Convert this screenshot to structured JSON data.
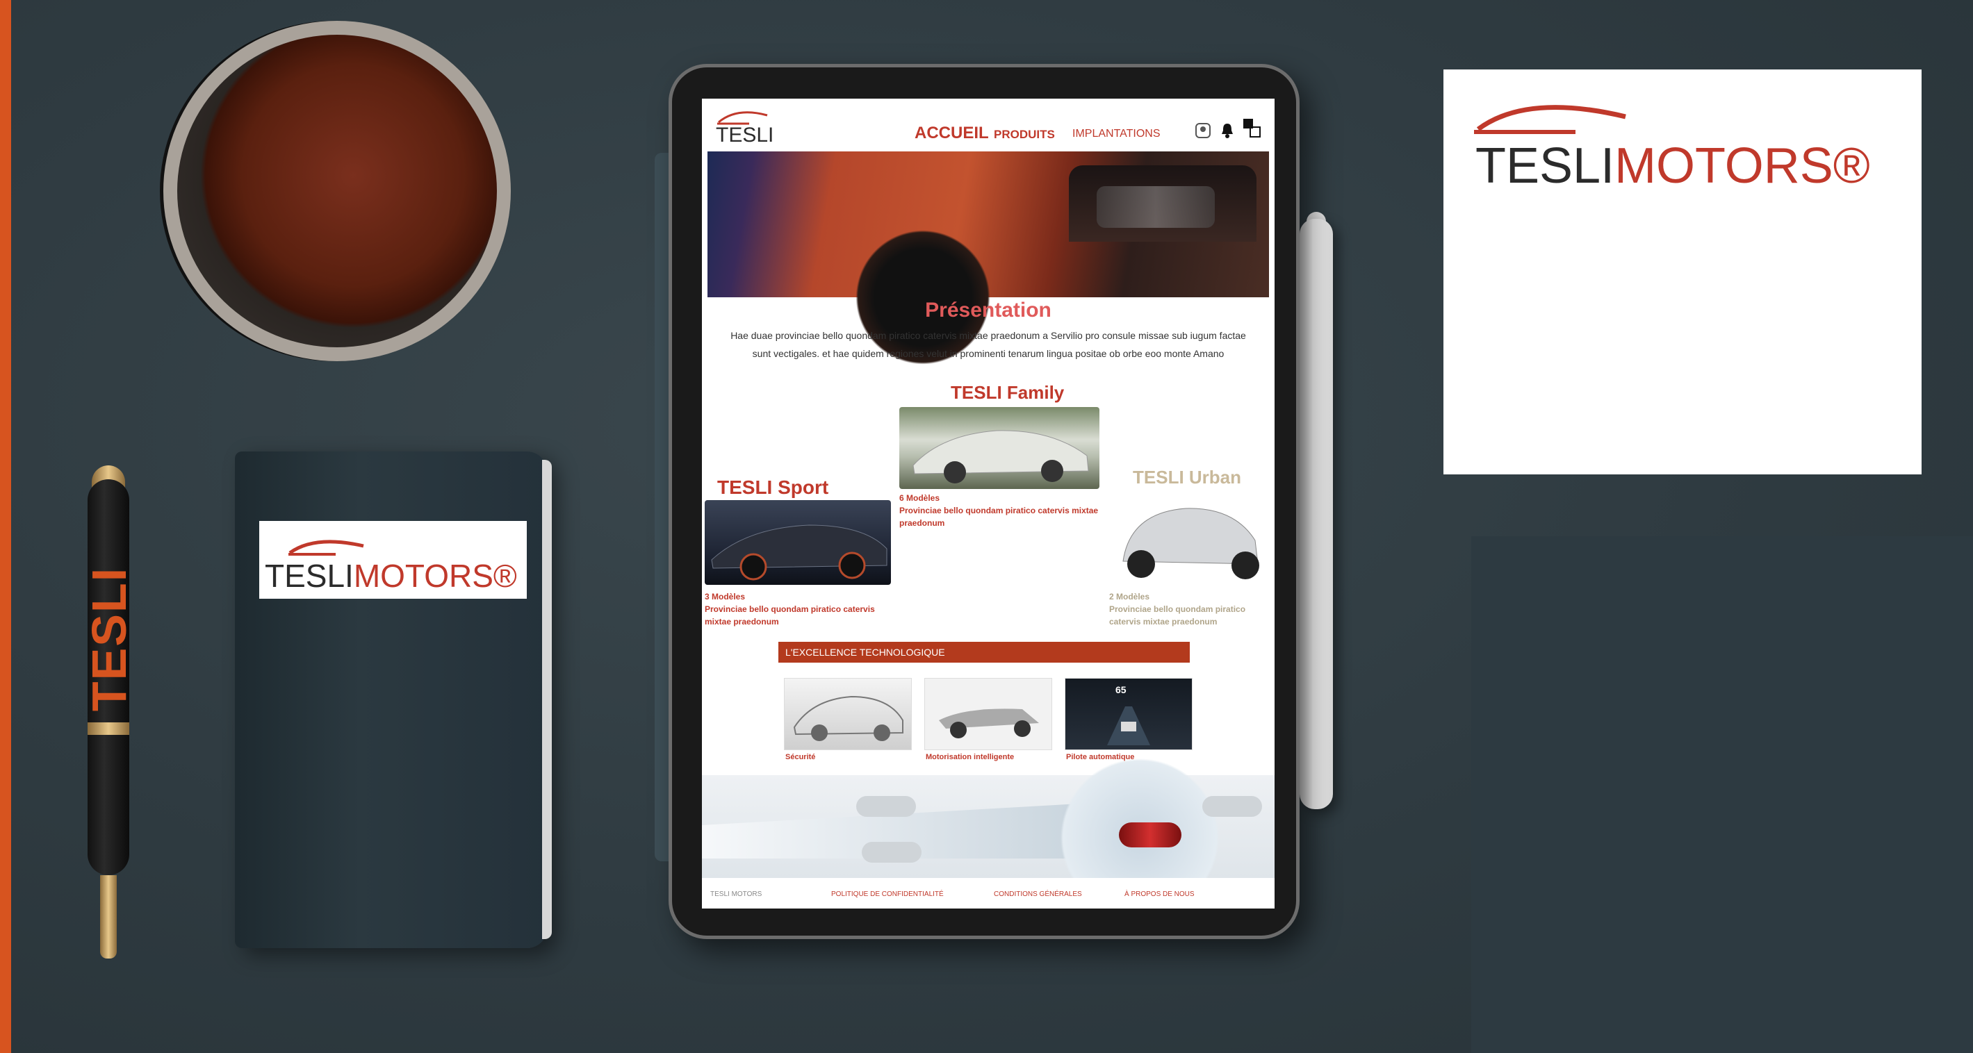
{
  "colors": {
    "brand": "#c0392b",
    "accent_orange": "#d7541f",
    "background": "#2f3b41"
  },
  "logo": {
    "tesli": "TESLI",
    "motors": "MOTORS®"
  },
  "pen": {
    "text": "TESLI"
  },
  "site": {
    "logo_text": "TESLI",
    "nav": {
      "home": "ACCUEIL",
      "products": "PRODUITS",
      "locations": "IMPLANTATIONS"
    },
    "header_icons": [
      "user-icon",
      "bell-icon",
      "cart-icon"
    ],
    "presentation": {
      "title": "Présentation",
      "text": "Hae duae provinciae bello quondam piratico catervis mixtae praedonum a Servilio pro consule missae sub iugum factae sunt vectigales. et hae quidem regiones velut in prominenti tenarum lingua positae ob orbe eoo monte Amano"
    },
    "family": {
      "family": {
        "title": "TESLI Family",
        "models": "6 Modèles",
        "desc": "Provinciae bello quondam piratico catervis mixtae praedonum"
      },
      "sport": {
        "title": "TESLI  Sport",
        "models": "3 Modèles",
        "desc": "Provinciae bello quondam piratico catervis mixtae praedonum"
      },
      "urban": {
        "title": "TESLI  Urban",
        "models": "2 Modèles",
        "desc": "Provinciae bello quondam piratico catervis mixtae praedonum"
      }
    },
    "tech": {
      "banner": "L'EXCELLENCE TECHNOLOGIQUE",
      "items": [
        {
          "caption": "Sécurité"
        },
        {
          "caption": "Motorisation intelligente"
        },
        {
          "caption": "Pilote automatique"
        }
      ],
      "dashboard_value": "65"
    },
    "footer": {
      "brand": "TESLI MOTORS",
      "links": [
        "POLITIQUE DE CONFIDENTIALITÉ",
        "CONDITIONS GÉNÉRALES",
        "À PROPOS DE NOUS"
      ]
    }
  }
}
